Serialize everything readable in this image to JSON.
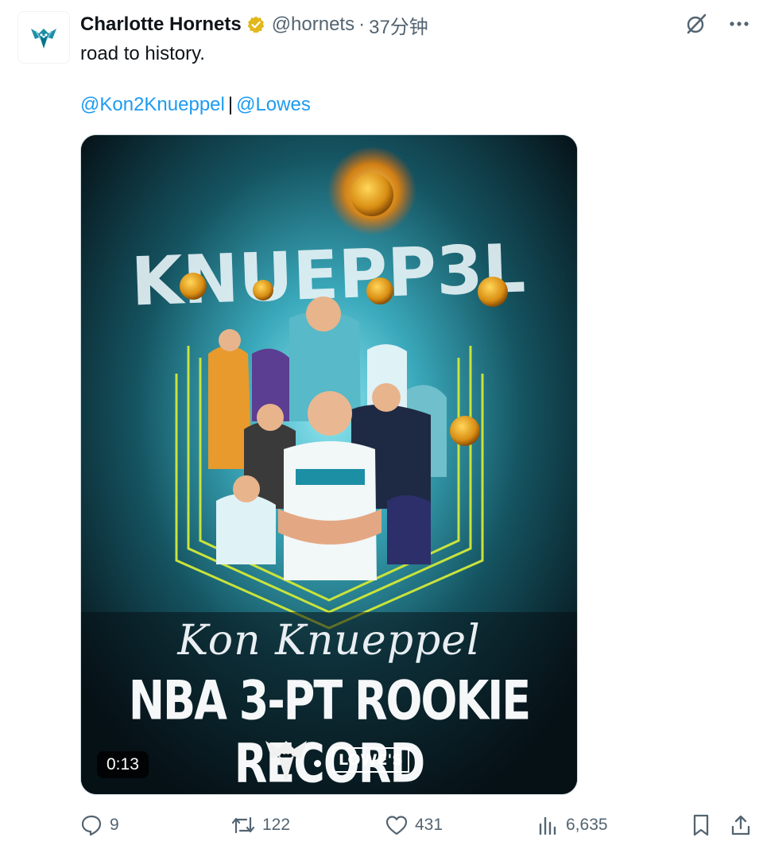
{
  "tweet": {
    "display_name": "Charlotte Hornets",
    "handle": "@hornets",
    "separator": "·",
    "timestamp": "37分钟",
    "text": "road to history.",
    "mentions": [
      "@Kon2Knueppel",
      "@Lowes"
    ],
    "mention_separator": "|"
  },
  "media": {
    "duration": "0:13",
    "name_script": "Kon Knueppel",
    "headline": "NBA 3-PT ROOKIE RECORD",
    "sponsor": "LOWE'S",
    "wordmark": "KNUEPP3L"
  },
  "stats": {
    "replies": "9",
    "reposts": "122",
    "likes": "431",
    "views": "6,635"
  },
  "colors": {
    "accent": "#1d9bf0",
    "verified": "#e2b719",
    "muted": "#536471"
  },
  "icons": {
    "avatar": "hornets-logo",
    "verified": "verified-badge-icon",
    "grok": "grok-icon",
    "more": "more-icon",
    "reply": "reply-icon",
    "repost": "repost-icon",
    "like": "like-icon",
    "views": "views-icon",
    "bookmark": "bookmark-icon",
    "share": "share-icon"
  }
}
